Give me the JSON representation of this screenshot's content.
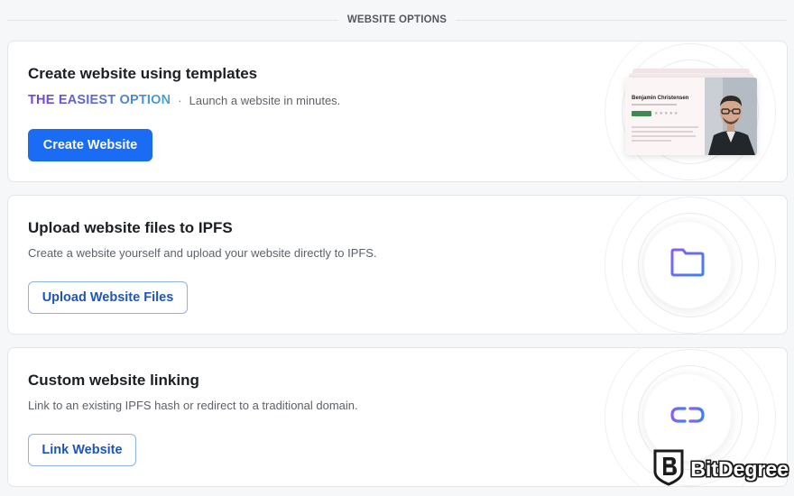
{
  "section": {
    "title": "WEBSITE OPTIONS"
  },
  "cards": [
    {
      "title": "Create website using templates",
      "highlight": "THE EASIEST OPTION",
      "separator": "·",
      "description": "Launch a website in minutes.",
      "button": "Create Website",
      "preview": {
        "name": "Benjamin Christensen",
        "stars": "★★★★★"
      }
    },
    {
      "title": "Upload website files to IPFS",
      "description": "Create a website yourself and upload your website directly to IPFS.",
      "button": "Upload Website Files",
      "icon": "folder-icon"
    },
    {
      "title": "Custom website linking",
      "description": "Link to an existing IPFS hash or redirect to a traditional domain.",
      "button": "Link Website",
      "icon": "link-icon"
    }
  ],
  "watermark": {
    "text": "BitDegree",
    "logo": "bitdegree-shield-logo"
  },
  "colors": {
    "primary": "#1a6cf5",
    "outline_text": "#1e55b8",
    "gradient_start": "#7b3fd4",
    "gradient_end": "#4aa3cc",
    "icon_gradient_start": "#8b5cf6",
    "icon_gradient_end": "#3b82f6"
  }
}
